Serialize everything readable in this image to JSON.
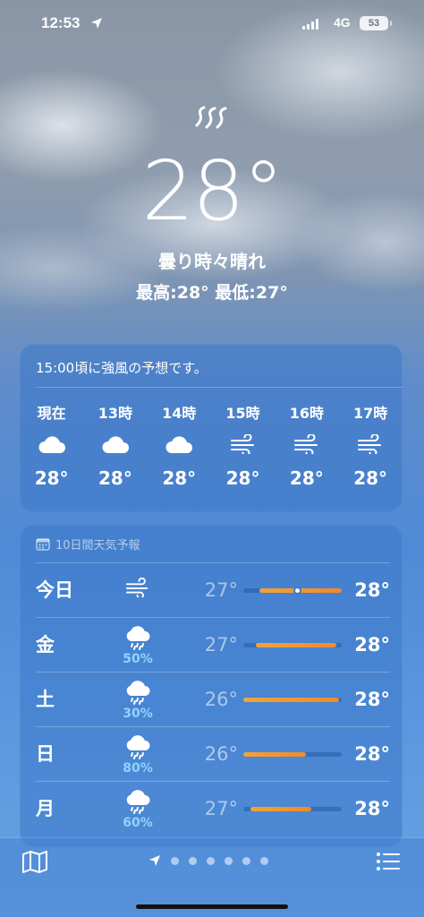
{
  "status_bar": {
    "time": "12:53",
    "network": "4G",
    "battery": "53"
  },
  "current": {
    "icon": "wind-icon",
    "temperature": "28°",
    "condition": "曇り時々晴れ",
    "high_low": "最高:28° 最低:27°"
  },
  "hourly": {
    "alert": "15:00頃に強風の予想です。",
    "items": [
      {
        "label": "現在",
        "icon": "cloud-icon",
        "temp": "28°"
      },
      {
        "label": "13時",
        "icon": "cloud-icon",
        "temp": "28°"
      },
      {
        "label": "14時",
        "icon": "cloud-icon",
        "temp": "28°"
      },
      {
        "label": "15時",
        "icon": "wind-icon",
        "temp": "28°"
      },
      {
        "label": "16時",
        "icon": "wind-icon",
        "temp": "28°"
      },
      {
        "label": "17時",
        "icon": "wind-icon",
        "temp": "28°"
      }
    ]
  },
  "daily": {
    "title": "10日間天気予報",
    "rows": [
      {
        "day": "今日",
        "icon": "wind-icon",
        "precip": "",
        "low": "27°",
        "high": "28°",
        "bar_start": 0.16,
        "bar_end": 1.0,
        "current_marker": 0.55
      },
      {
        "day": "金",
        "icon": "rain-cloud-icon",
        "precip": "50%",
        "low": "27°",
        "high": "28°",
        "bar_start": 0.13,
        "bar_end": 0.95
      },
      {
        "day": "土",
        "icon": "rain-cloud-icon",
        "precip": "30%",
        "low": "26°",
        "high": "28°",
        "bar_start": 0.0,
        "bar_end": 0.97
      },
      {
        "day": "日",
        "icon": "rain-cloud-icon",
        "precip": "80%",
        "low": "26°",
        "high": "28°",
        "bar_start": 0.0,
        "bar_end": 0.64
      },
      {
        "day": "月",
        "icon": "rain-cloud-icon",
        "precip": "60%",
        "low": "27°",
        "high": "28°",
        "bar_start": 0.07,
        "bar_end": 0.69
      }
    ]
  },
  "bottom_bar": {
    "pages": 6,
    "current_page": 0
  },
  "colors": {
    "accent_orange": "#f2a33a",
    "precip_blue": "#8fd4ff"
  }
}
